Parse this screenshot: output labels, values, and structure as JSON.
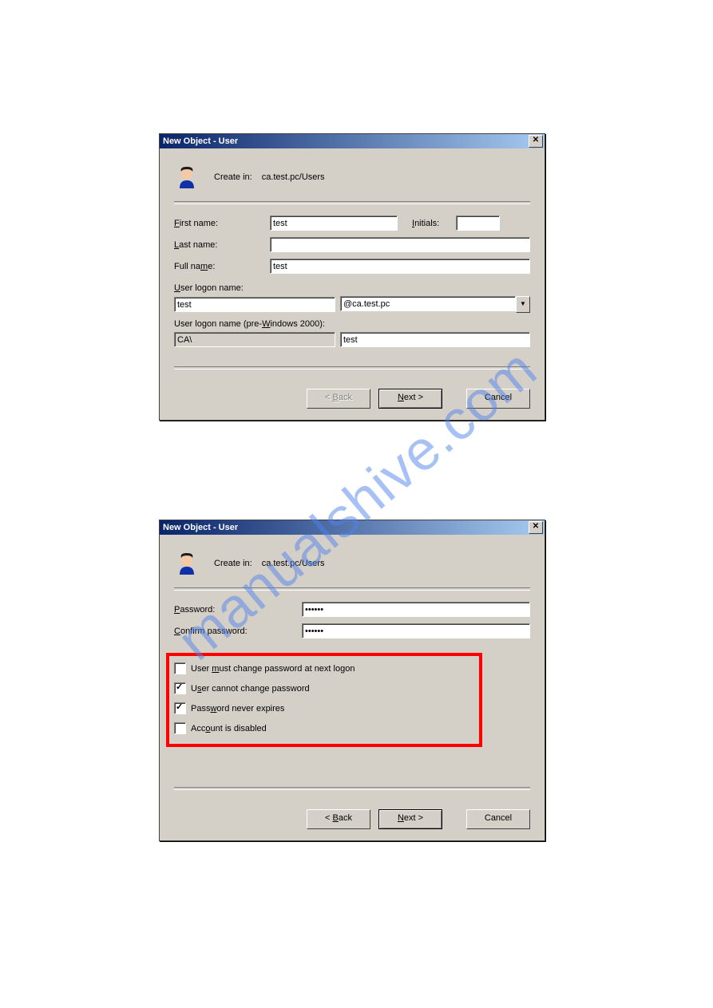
{
  "watermark": "manualshive.com",
  "dialog1": {
    "title": "New Object - User",
    "create_in_label": "Create in:",
    "create_in_path": "ca.test.pc/Users",
    "fields": {
      "first_name_label_pre": "F",
      "first_name_label_post": "irst name:",
      "first_name_value": "test",
      "initials_label_pre": "I",
      "initials_label_post": "nitials:",
      "initials_value": "",
      "last_name_label_pre": "L",
      "last_name_label_post": "ast name:",
      "last_name_value": "",
      "full_name_label_pre": "Full na",
      "full_name_label_u": "m",
      "full_name_label_post": "e:",
      "full_name_value": "test",
      "logon_label_pre": "U",
      "logon_label_post": "ser logon name:",
      "logon_value": "test",
      "logon_domain": "@ca.test.pc",
      "pre2000_label_pre": "User logon name (pre-",
      "pre2000_label_u": "W",
      "pre2000_label_post": "indows 2000):",
      "pre2000_domain": "CA\\",
      "pre2000_value": "test"
    },
    "buttons": {
      "back_pre": "< ",
      "back_u": "B",
      "back_post": "ack",
      "next_u": "N",
      "next_post": "ext >",
      "cancel": "Cancel"
    }
  },
  "dialog2": {
    "title": "New Object - User",
    "create_in_label": "Create in:",
    "create_in_path": "ca.test.pc/Users",
    "fields": {
      "pwd_label_pre": "P",
      "pwd_label_post": "assword:",
      "pwd_value": "••••••",
      "cpwd_label_pre": "C",
      "cpwd_label_post": "onfirm password:",
      "cpwd_value": "••••••"
    },
    "checks": {
      "c1_pre": "User ",
      "c1_u": "m",
      "c1_post": "ust change password at next logon",
      "c1_checked": false,
      "c2_pre": "U",
      "c2_u": "s",
      "c2_post": "er cannot change password",
      "c2_checked": true,
      "c3_pre": "Pass",
      "c3_u": "w",
      "c3_post": "ord never expires",
      "c3_checked": true,
      "c4_pre": "Acc",
      "c4_u": "o",
      "c4_post": "unt is disabled",
      "c4_checked": false
    },
    "buttons": {
      "back_pre": "< ",
      "back_u": "B",
      "back_post": "ack",
      "next_u": "N",
      "next_post": "ext >",
      "cancel": "Cancel"
    }
  }
}
